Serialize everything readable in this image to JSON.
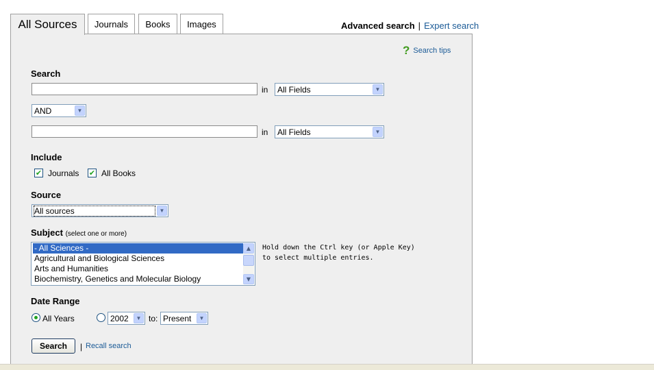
{
  "tabs": [
    {
      "label": "All Sources",
      "active": true
    },
    {
      "label": "Journals",
      "active": false
    },
    {
      "label": "Books",
      "active": false
    },
    {
      "label": "Images",
      "active": false
    }
  ],
  "top_links": {
    "advanced": "Advanced search",
    "separator": "|",
    "expert": "Expert search"
  },
  "search_tips": {
    "icon": "question-mark-icon",
    "label": "Search tips"
  },
  "search": {
    "heading": "Search",
    "term1_value": "",
    "in_label": "in",
    "field1": "All Fields",
    "operator": "AND",
    "term2_value": "",
    "field2": "All Fields"
  },
  "include": {
    "heading": "Include",
    "journals_label": "Journals",
    "journals_checked": true,
    "books_label": "All Books",
    "books_checked": true
  },
  "source": {
    "heading": "Source",
    "selected": "All sources"
  },
  "subject": {
    "heading": "Subject",
    "hint": "(select one or more)",
    "options": [
      {
        "label": "- All Sciences -",
        "selected": true
      },
      {
        "label": "Agricultural and Biological Sciences",
        "selected": false
      },
      {
        "label": "Arts and Humanities",
        "selected": false
      },
      {
        "label": "Biochemistry, Genetics and Molecular Biology",
        "selected": false
      }
    ],
    "help_line1": "Hold down the Ctrl key (or Apple Key)",
    "help_line2": "to select multiple entries."
  },
  "date_range": {
    "heading": "Date Range",
    "all_years_label": "All Years",
    "all_years_selected": true,
    "from_year": "2002",
    "to_label": "to:",
    "to_value": "Present"
  },
  "actions": {
    "search_button": "Search",
    "separator": "|",
    "recall_link": "Recall search"
  },
  "colors": {
    "link": "#1a5a96",
    "panel": "#efefef",
    "check": "#21a121",
    "selection": "#316ac5"
  }
}
